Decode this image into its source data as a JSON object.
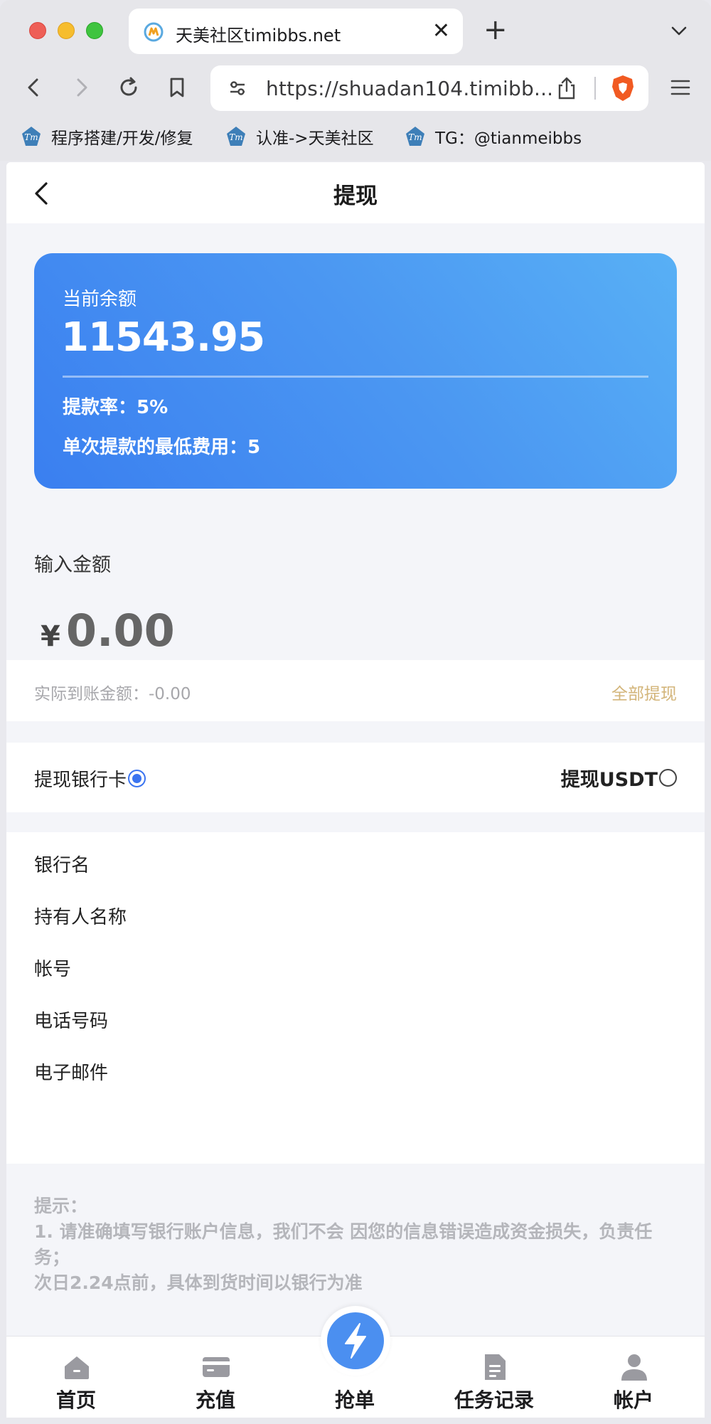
{
  "browser": {
    "tab_title": "天美社区timibbs.net",
    "url": "https://shuadan104.timibb...",
    "bookmarks": [
      {
        "label": "程序搭建/开发/修复"
      },
      {
        "label": "认准->天美社区"
      },
      {
        "label": "TG：@tianmeibbs"
      }
    ]
  },
  "page": {
    "title": "提现",
    "balance": {
      "label": "当前余额",
      "value": "11543.95",
      "rate": "提款率：5%",
      "min_fee": "单次提款的最低费用：5"
    },
    "amount": {
      "label": "输入金额",
      "currency": "¥",
      "value": "0.00",
      "actual": "实际到账金额：-0.00",
      "withdraw_all": "全部提现"
    },
    "methods": {
      "bank": "提现银行卡",
      "usdt": "提现USDT",
      "selected": "bank"
    },
    "fields": [
      "银行名",
      "持有人名称",
      "帐号",
      "电话号码",
      "电子邮件"
    ],
    "tips": {
      "title": "提示：",
      "line1": "1. 请准确填写银行账户信息，我们不会 因您的信息错误造成资金损失，负责任务；",
      "line2": "次日2.24点前，具体到货时间以银行为准"
    },
    "tabbar": [
      {
        "label": "首页",
        "icon": "home-icon"
      },
      {
        "label": "充值",
        "icon": "card-icon"
      },
      {
        "label": "抢单",
        "icon": "lightning-icon"
      },
      {
        "label": "任务记录",
        "icon": "document-icon"
      },
      {
        "label": "帐户",
        "icon": "user-icon"
      }
    ]
  },
  "colors": {
    "accent": "#3b74f0",
    "card_start": "#3a7ff0",
    "card_end": "#58b0f5",
    "gold": "#d3b57a"
  }
}
